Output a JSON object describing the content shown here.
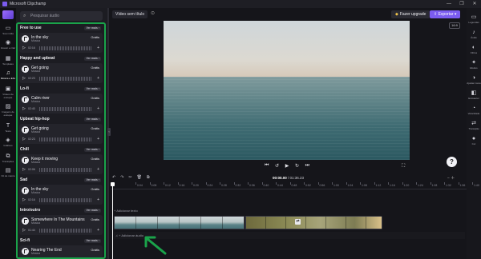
{
  "window": {
    "title": "Microsoft Clipchamp",
    "controls": [
      "—",
      "❐",
      "✕"
    ]
  },
  "leftnav": {
    "items": [
      {
        "label": "Sua mídia",
        "icon": "folder-icon"
      },
      {
        "label": "Gravar e criar",
        "icon": "record-icon"
      },
      {
        "label": "Templates",
        "icon": "templates-icon"
      },
      {
        "label": "Música e EFs",
        "icon": "music-icon",
        "active": true
      },
      {
        "label": "Vídeos de estoque",
        "icon": "video-icon"
      },
      {
        "label": "Imagens de estoque",
        "icon": "image-icon"
      },
      {
        "label": "Texto",
        "icon": "text-icon"
      },
      {
        "label": "Gráficos",
        "icon": "graphics-icon"
      },
      {
        "label": "Transições",
        "icon": "transitions-icon"
      },
      {
        "label": "Kit de marca",
        "icon": "brand-kit-icon"
      }
    ]
  },
  "search": {
    "placeholder": "Pesquisar áudio"
  },
  "sections": [
    {
      "title": "Free to use",
      "see_all": "Ver mais",
      "track": {
        "name": "In the sky",
        "sub": "Música",
        "badge": "Grátis",
        "duration": "02:16"
      }
    },
    {
      "title": "Happy and upbeat",
      "see_all": "Ver mais",
      "track": {
        "name": "Get going",
        "sub": "Música",
        "badge": "Grátis",
        "duration": "02:23"
      }
    },
    {
      "title": "Lo-fi",
      "see_all": "Ver mais",
      "track": {
        "name": "Calm river",
        "sub": "Música",
        "badge": "Grátis",
        "duration": "02:40"
      }
    },
    {
      "title": "Upbeat hip-hop",
      "see_all": "Ver mais",
      "track": {
        "name": "Get going",
        "sub": "Música",
        "badge": "Grátis",
        "duration": "02:23"
      }
    },
    {
      "title": "Chill",
      "see_all": "Ver mais",
      "track": {
        "name": "Keep it moving",
        "sub": "Música",
        "badge": "Grátis",
        "duration": "02:06"
      }
    },
    {
      "title": "Sad",
      "see_all": "Ver mais",
      "track": {
        "name": "In the sky",
        "sub": "Música",
        "badge": "Grátis",
        "duration": "02:16"
      }
    },
    {
      "title": "Intro/outro",
      "see_all": "Ver mais",
      "track": {
        "name": "Somewhere In The Mountains",
        "sub": "Música",
        "badge": "Grátis",
        "duration": "01:44"
      }
    },
    {
      "title": "Sci-fi",
      "see_all": "Ver mais",
      "track": {
        "name": "Nearing The End",
        "sub": "Música",
        "badge": "Grátis",
        "duration": ""
      }
    }
  ],
  "topbar": {
    "project_name": "Vídeo sem título",
    "upgrade": "Fazer upgrade",
    "export": "Exportar"
  },
  "player": {
    "ratio": "16:9",
    "time_current": "00:00.00",
    "time_total": "01:36.23"
  },
  "timeline": {
    "ruler": [
      "0:04",
      "0:08",
      "0:12",
      "0:16",
      "0:20",
      "0:24",
      "0:28",
      "0:32",
      "0:36",
      "0:40",
      "0:44",
      "0:48",
      "0:52",
      "0:56",
      "1:00",
      "1:04",
      "1:08",
      "1:12",
      "1:16",
      "1:20",
      "1:24",
      "1:28",
      "1:32",
      "1:36",
      "1:40"
    ],
    "add_text": "+ Adicionar texto",
    "add_audio": "♫ + Adicionar áudio"
  },
  "rightnav": {
    "items": [
      {
        "label": "Legendas",
        "icon": "captions-icon"
      },
      {
        "label": "Áudio",
        "icon": "audio-icon"
      },
      {
        "label": "Filtros",
        "icon": "filters-icon"
      },
      {
        "label": "Efeitos",
        "icon": "effects-icon"
      },
      {
        "label": "Ajustar cores",
        "icon": "color-icon"
      },
      {
        "label": "Esmaecer",
        "icon": "fade-icon"
      },
      {
        "label": "Velocidade",
        "icon": "speed-icon"
      },
      {
        "label": "Transição",
        "icon": "transition-icon"
      },
      {
        "label": "Cor",
        "icon": "palette-icon"
      }
    ]
  },
  "colors": {
    "accent": "#7b5cf0",
    "highlight_box": "#1aa34a",
    "arrow": "#1aa34a"
  }
}
